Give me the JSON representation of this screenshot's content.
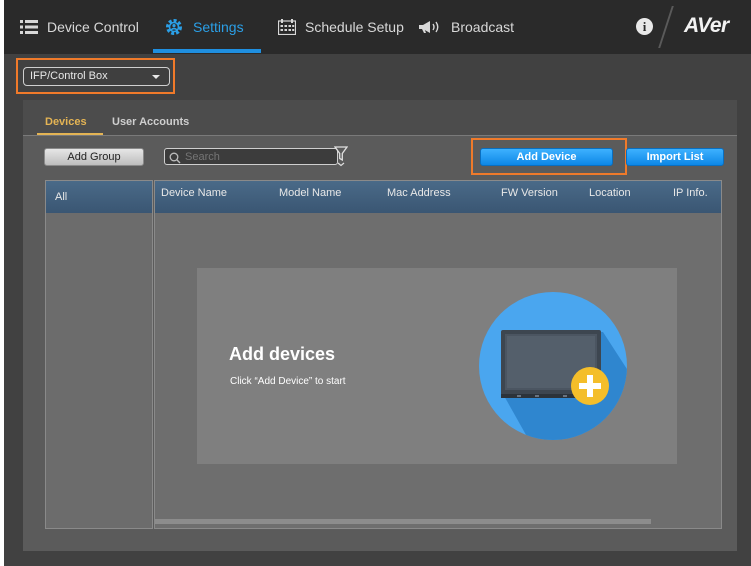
{
  "nav": {
    "items": [
      {
        "label": "Device Control",
        "icon": "list-icon"
      },
      {
        "label": "Settings",
        "icon": "gear-icon",
        "active": true
      },
      {
        "label": "Schedule Setup",
        "icon": "calendar-icon"
      },
      {
        "label": "Broadcast",
        "icon": "megaphone-icon"
      }
    ],
    "info_symbol": "i",
    "logo": "AVer"
  },
  "device_type": {
    "value": "IFP/Control Box"
  },
  "tabs": [
    {
      "label": "Devices",
      "active": true
    },
    {
      "label": "User Accounts"
    }
  ],
  "toolbar": {
    "add_group_label": "Add Group",
    "search_placeholder": "Search",
    "add_device_label": "Add Device",
    "import_list_label": "Import List"
  },
  "groups": {
    "items": [
      "All"
    ]
  },
  "table": {
    "columns": [
      "Device Name",
      "Model Name",
      "Mac Address",
      "FW Version",
      "Location",
      "IP Info."
    ]
  },
  "empty_state": {
    "title": "Add devices",
    "subtitle": "Click “Add Device” to start"
  },
  "colors": {
    "accent_blue": "#1f8fe0",
    "tab_active": "#e4b454",
    "highlight_orange": "#f07a2a"
  }
}
